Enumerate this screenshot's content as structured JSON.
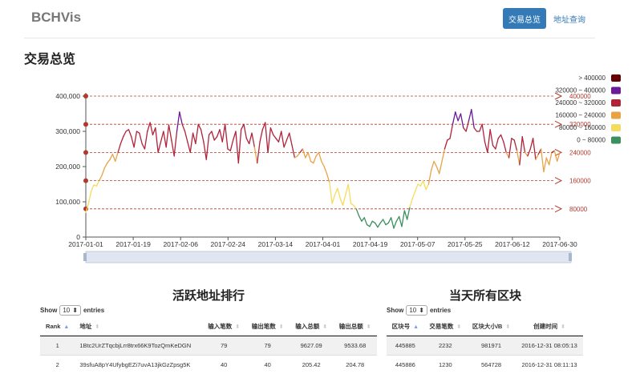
{
  "nav": {
    "brand": "BCHVis",
    "active_tab": "交易总览",
    "link": "地址查询"
  },
  "page_title": "交易总览",
  "chart_data": {
    "type": "line",
    "title": "",
    "xlabel": "",
    "ylabel": "",
    "ylim": [
      0,
      400000
    ],
    "y_ticks": [
      "0",
      "100,000",
      "200,000",
      "300,000",
      "400,000"
    ],
    "x_ticks": [
      "2017-01-01",
      "2017-01-19",
      "2017-02-06",
      "2017-02-24",
      "2017-03-14",
      "2017-04-01",
      "2017-04-19",
      "2017-05-07",
      "2017-05-25",
      "2017-06-12",
      "2017-06-30"
    ],
    "x_range": [
      "2017-01-01",
      "2017-06-30"
    ],
    "mark_lines": [
      {
        "value": 80000,
        "label": "80000"
      },
      {
        "value": 160000,
        "label": "160000"
      },
      {
        "value": 240000,
        "label": "240000"
      },
      {
        "value": 320000,
        "label": "320000"
      },
      {
        "value": 400000,
        "label": "400000"
      }
    ],
    "visual_map": [
      {
        "label": "> 400000",
        "min": 400000,
        "max": null,
        "color": "#660000"
      },
      {
        "label": "320000 ~ 400000",
        "min": 320000,
        "max": 400000,
        "color": "#6a1b9a"
      },
      {
        "label": "240000 ~ 320000",
        "min": 240000,
        "max": 320000,
        "color": "#b0233a"
      },
      {
        "label": "160000 ~ 240000",
        "min": 160000,
        "max": 240000,
        "color": "#e8a347"
      },
      {
        "label": "80000 ~ 160000",
        "min": 80000,
        "max": 160000,
        "color": "#f5dc5e"
      },
      {
        "label": "0 ~ 80000",
        "min": 0,
        "max": 80000,
        "color": "#3d8f5e"
      }
    ],
    "series": [
      {
        "values": [
          70000,
          95000,
          130000,
          148000,
          145000,
          160000,
          175000,
          196000,
          210000,
          220000,
          235000,
          215000,
          240000,
          265000,
          285000,
          300000,
          305000,
          285000,
          255000,
          300000,
          295000,
          265000,
          250000,
          300000,
          325000,
          290000,
          310000,
          240000,
          270000,
          300000,
          255000,
          318000,
          275000,
          230000,
          300000,
          355000,
          320000,
          300000,
          270000,
          240000,
          295000,
          265000,
          320000,
          305000,
          270000,
          220000,
          290000,
          300000,
          275000,
          285000,
          305000,
          270000,
          320000,
          250000,
          245000,
          275000,
          300000,
          210000,
          305000,
          320000,
          280000,
          265000,
          295000,
          255000,
          210000,
          270000,
          305000,
          325000,
          240000,
          310000,
          290000,
          280000,
          270000,
          300000,
          255000,
          275000,
          295000,
          260000,
          225000,
          230000,
          240000,
          250000,
          225000,
          240000,
          215000,
          210000,
          230000,
          240000,
          215000,
          200000,
          180000,
          155000,
          95000,
          120000,
          138000,
          110000,
          90000,
          120000,
          150000,
          95000,
          90000,
          80000,
          60000,
          45000,
          55000,
          35000,
          30000,
          45000,
          40000,
          28000,
          40000,
          50000,
          35000,
          40000,
          55000,
          25000,
          45000,
          58000,
          30000,
          75000,
          50000,
          85000,
          110000,
          130000,
          150000,
          145000,
          160000,
          135000,
          150000,
          190000,
          215000,
          200000,
          180000,
          215000,
          250000,
          275000,
          280000,
          320000,
          355000,
          330000,
          350000,
          310000,
          300000,
          330000,
          362000,
          310000,
          300000,
          300000,
          320000,
          270000,
          240000,
          305000,
          260000,
          250000,
          280000,
          290000,
          270000,
          240000,
          225000,
          280000,
          275000,
          245000,
          205000,
          285000,
          240000,
          230000,
          250000,
          280000,
          220000,
          235000,
          250000,
          185000,
          225000,
          205000,
          240000,
          245000,
          215000,
          240000
        ]
      }
    ]
  },
  "active_addresses": {
    "title": "活跃地址排行",
    "show": "Show",
    "page_size": "10",
    "entries": "entries",
    "columns": [
      "Rank",
      "地址",
      "输入笔数",
      "输出笔数",
      "输入总额",
      "输出总额"
    ],
    "rows": [
      [
        "1",
        "1Btc2UrZTqcbjLrr8trx66K9TozQmKeDGN",
        "79",
        "79",
        "9627.09",
        "9533.68"
      ],
      [
        "2",
        "39sfuA8pY4UfybgEZi7uvA13jkGzZpsg5K",
        "40",
        "40",
        "205.42",
        "204.78"
      ]
    ]
  },
  "blocks": {
    "title": "当天所有区块",
    "show": "Show",
    "page_size": "10",
    "entries": "entries",
    "columns": [
      "区块号",
      "交易笔数",
      "区块大小/B",
      "创建时间"
    ],
    "rows": [
      [
        "445885",
        "2232",
        "981971",
        "2016-12-31 08:05:13"
      ],
      [
        "445886",
        "1230",
        "564728",
        "2016-12-31 08:11:13"
      ]
    ]
  }
}
